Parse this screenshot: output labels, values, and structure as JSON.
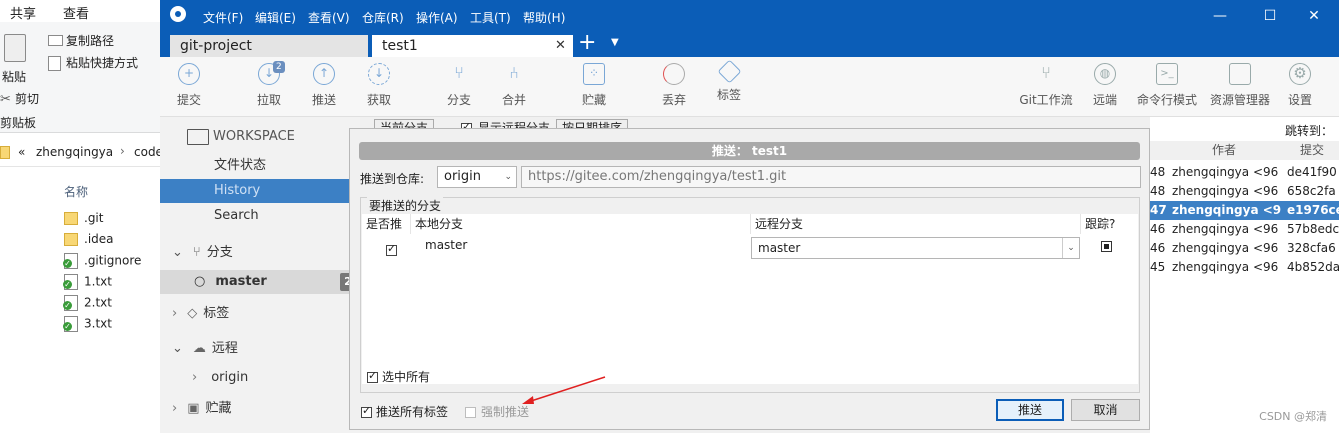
{
  "explorer": {
    "ribbon_tabs": [
      "共享",
      "查看"
    ],
    "copy_path": "复制路径",
    "paste_shortcut": "粘贴快捷方式",
    "paste": "粘贴",
    "cut": "剪切",
    "clipboard_group": "剪贴板",
    "breadcrumb": [
      "«",
      "zhengqingya",
      "›",
      "code"
    ],
    "col_name": "名称",
    "files": [
      {
        "name": ".git",
        "icon": "folder-icon"
      },
      {
        "name": ".idea",
        "icon": "folder-icon"
      },
      {
        "name": ".gitignore",
        "icon": "git-file-icon"
      },
      {
        "name": "1.txt",
        "icon": "git-file-icon"
      },
      {
        "name": "2.txt",
        "icon": "git-file-icon"
      },
      {
        "name": "3.txt",
        "icon": "git-file-icon"
      }
    ]
  },
  "sourcetree": {
    "menus": [
      "文件(F)",
      "编辑(E)",
      "查看(V)",
      "仓库(R)",
      "操作(A)",
      "工具(T)",
      "帮助(H)"
    ],
    "tabs": [
      {
        "label": "git-project"
      },
      {
        "label": "test1"
      }
    ],
    "toolbar_left": [
      {
        "label": "提交",
        "icon": "plus"
      },
      {
        "label": "拉取",
        "icon": "down",
        "badge": "2"
      },
      {
        "label": "推送",
        "icon": "up"
      },
      {
        "label": "获取",
        "icon": "fetch"
      },
      {
        "label": "分支",
        "icon": "branch"
      },
      {
        "label": "合并",
        "icon": "merge"
      },
      {
        "label": "贮藏",
        "icon": "stash"
      },
      {
        "label": "丢弃",
        "icon": "discard"
      },
      {
        "label": "标签",
        "icon": "tag"
      }
    ],
    "toolbar_right": [
      {
        "label": "Git工作流",
        "icon": "flow"
      },
      {
        "label": "远端",
        "icon": "globe"
      },
      {
        "label": "命令行模式",
        "icon": "terminal"
      },
      {
        "label": "资源管理器",
        "icon": "folder"
      },
      {
        "label": "设置",
        "icon": "gear"
      }
    ],
    "sidebar": {
      "workspace": "WORKSPACE",
      "file_status": "文件状态",
      "history": "History",
      "search": "Search",
      "branches": "分支",
      "current_branch": "master",
      "branch_count": "2",
      "tags": "标签",
      "remotes": "远程",
      "remote_origin": "origin",
      "stashes": "贮藏"
    },
    "history_toolbar": {
      "branch_filter": "当前分支",
      "show_remote": "显示远程分支",
      "sort": "按日期排序",
      "jump_to": "跳转到："
    },
    "commit_columns": {
      "author": "作者",
      "commit": "提交"
    },
    "commits": [
      {
        "n": "48",
        "author": "zhengqingya <96",
        "hash": "de41f90"
      },
      {
        "n": "48",
        "author": "zhengqingya <96",
        "hash": "658c2fa"
      },
      {
        "n": "47",
        "author": "zhengqingya <9",
        "hash": "e1976ce"
      },
      {
        "n": "46",
        "author": "zhengqingya <96",
        "hash": "57b8edc"
      },
      {
        "n": "46",
        "author": "zhengqingya <96",
        "hash": "328cfa6"
      },
      {
        "n": "45",
        "author": "zhengqingya <96",
        "hash": "4b852da"
      }
    ]
  },
  "dialog": {
    "title": "推送： test1",
    "push_to_repo_label": "推送到仓库:",
    "remote": "origin",
    "url": "https://gitee.com/zhengqingya/test1.git",
    "branches_group": "要推送的分支",
    "columns": {
      "push": "是否推",
      "local": "本地分支",
      "remote": "远程分支",
      "track": "跟踪?"
    },
    "rows": [
      {
        "push": true,
        "local": "master",
        "remote": "master",
        "track": true
      }
    ],
    "select_all": "选中所有",
    "push_all_tags": "推送所有标签",
    "force_push": "强制推送",
    "ok": "推送",
    "cancel": "取消"
  },
  "watermark": "CSDN @郑清"
}
